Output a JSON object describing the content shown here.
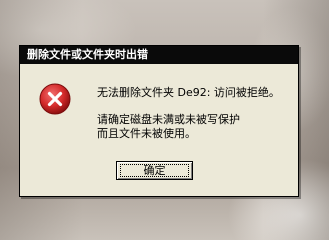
{
  "dialog": {
    "title": "删除文件或文件夹时出错",
    "message_line1": "无法删除文件夹 De92: 访问被拒绝。",
    "message_line2": "请确定磁盘未满或未被写保护",
    "message_line3": "而且文件未被使用。",
    "ok_label": "确定",
    "icon": "error-icon"
  },
  "colors": {
    "titlebar": "#0a0a0a",
    "dialog_bg": "#ece9d8",
    "error_red": "#cc2020"
  }
}
